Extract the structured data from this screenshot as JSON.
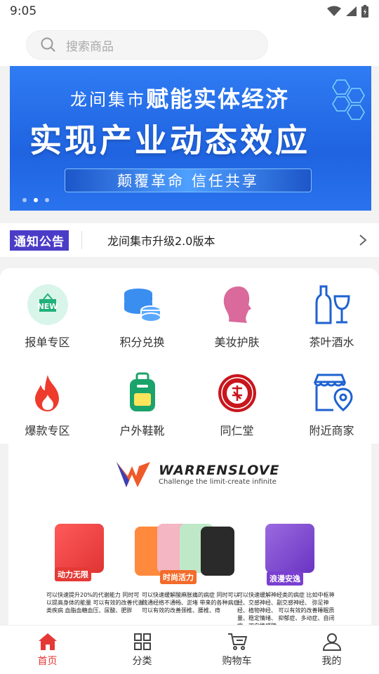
{
  "status": {
    "time": "9:05"
  },
  "search": {
    "placeholder": "搜索商品"
  },
  "banner": {
    "brand": "龙间集市",
    "headline": "赋能实体经济",
    "main": "实现产业动态效应",
    "sub": "颠覆革命  信任共享"
  },
  "notice": {
    "tag": "通知公告",
    "text": "龙间集市升级2.0版本"
  },
  "categories": [
    {
      "label": "报单专区",
      "icon": "new-badge-icon"
    },
    {
      "label": "积分兑换",
      "icon": "coins-icon"
    },
    {
      "label": "美妆护肤",
      "icon": "woman-head-icon"
    },
    {
      "label": "茶叶酒水",
      "icon": "wine-icon"
    },
    {
      "label": "爆款专区",
      "icon": "flame-icon"
    },
    {
      "label": "户外鞋靴",
      "icon": "backpack-icon"
    },
    {
      "label": "同仁堂",
      "icon": "tongrentang-seal-icon"
    },
    {
      "label": "附近商家",
      "icon": "store-location-icon"
    }
  ],
  "product": {
    "brand": "WARRENSLOVE",
    "slogan": "Challenge the limit-create infinite",
    "tags": [
      "动力无限",
      "时尚活力",
      "浪漫安逸"
    ],
    "descs": [
      "可以快速提升20%的代谢能力 同时可以提高身体的能量 可以有效的改善代谢类疾病 血脂血糖血压、尿酸、肥胖",
      "可以快速缓解酸麻胀痛的病症 同时可以疏通经络不通畅、淤堵 带来的各种病症 可以有效的改善颈椎、腰椎、痔",
      "可以快速缓解神经类的病症 比如中枢神经、交感神经、副交感神经、 弥足神经、植物神经、 可以有效的改善睡眠质量、稳定情绪、 抑郁症、多动症、自闭症、双向情感障"
    ]
  },
  "tabs": [
    {
      "label": "首页",
      "icon": "home-icon"
    },
    {
      "label": "分类",
      "icon": "grid-icon"
    },
    {
      "label": "购物车",
      "icon": "cart-icon"
    },
    {
      "label": "我的",
      "icon": "user-icon"
    }
  ],
  "colors": {
    "accent": "#e53935",
    "banner": "#2f7cf3",
    "notice_tag": "#4b3cc8"
  }
}
